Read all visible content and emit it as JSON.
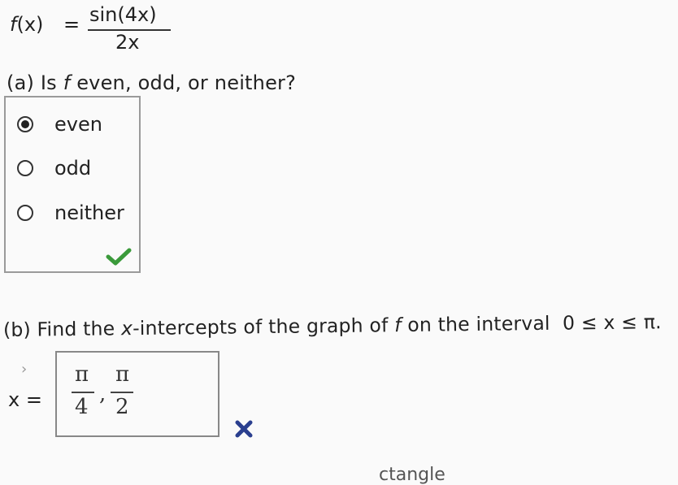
{
  "function": {
    "lhs_name": "f",
    "lhs_arg": "(x)",
    "equals": "=",
    "numerator": "sin(4x)",
    "denominator": "2x"
  },
  "part_a": {
    "label": "(a)",
    "question_prefix": "Is",
    "question_var": "f",
    "question_suffix": "even, odd, or neither?",
    "options": [
      {
        "label": "even",
        "selected": true
      },
      {
        "label": "odd",
        "selected": false
      },
      {
        "label": "neither",
        "selected": false
      }
    ],
    "result_icon": "checkmark-icon",
    "result_color": "#3a9a3a"
  },
  "part_b": {
    "label": "(b)",
    "question_pre": "Find the",
    "question_var": "x",
    "question_mid": "-intercepts of the graph of",
    "question_var2": "f",
    "question_post": "on the interval",
    "interval": "0 ≤ x ≤ π.",
    "answer_label": "x =",
    "answer": {
      "frac1_num": "π",
      "frac1_den": "4",
      "separator": ",",
      "frac2_num": "π",
      "frac2_den": "2"
    },
    "result_icon": "cross-icon",
    "result_color": "#2a3f8f"
  },
  "footer_partial_text": "ctangle"
}
